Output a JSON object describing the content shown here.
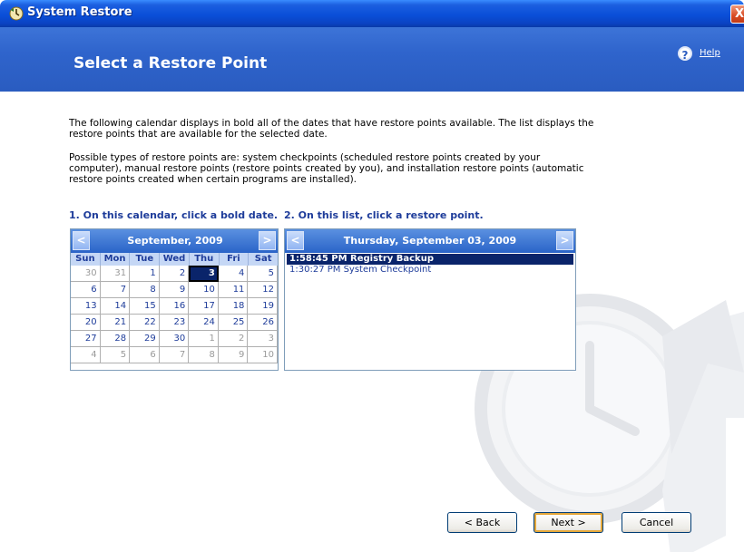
{
  "window": {
    "title": "System Restore",
    "close_glyph": "X"
  },
  "header": {
    "page_title": "Select a Restore Point",
    "help_label": "Help",
    "help_glyph": "?"
  },
  "intro": {
    "para1": "The following calendar displays in bold all of the dates that have restore points available. The list displays the restore points that are available for the selected date.",
    "para2": "Possible types of restore points are: system checkpoints (scheduled restore points created by your computer), manual restore points (restore points created by you), and installation restore points (automatic restore points created when certain programs are installed)."
  },
  "steps": {
    "step1": "1. On this calendar, click a bold date.",
    "step2": "2. On this list, click a restore point."
  },
  "calendar": {
    "prev_glyph": "<",
    "next_glyph": ">",
    "month": "September, 2009",
    "weekdays": [
      "Sun",
      "Mon",
      "Tue",
      "Wed",
      "Thu",
      "Fri",
      "Sat"
    ],
    "days": [
      {
        "label": "30",
        "state": "other"
      },
      {
        "label": "31",
        "state": "other"
      },
      {
        "label": "1",
        "state": "current"
      },
      {
        "label": "2",
        "state": "current"
      },
      {
        "label": "3",
        "state": "selected"
      },
      {
        "label": "4",
        "state": "current"
      },
      {
        "label": "5",
        "state": "current"
      },
      {
        "label": "6",
        "state": "current"
      },
      {
        "label": "7",
        "state": "current"
      },
      {
        "label": "8",
        "state": "current"
      },
      {
        "label": "9",
        "state": "current"
      },
      {
        "label": "10",
        "state": "current"
      },
      {
        "label": "11",
        "state": "current"
      },
      {
        "label": "12",
        "state": "current"
      },
      {
        "label": "13",
        "state": "current"
      },
      {
        "label": "14",
        "state": "current"
      },
      {
        "label": "15",
        "state": "current"
      },
      {
        "label": "16",
        "state": "current"
      },
      {
        "label": "17",
        "state": "current"
      },
      {
        "label": "18",
        "state": "current"
      },
      {
        "label": "19",
        "state": "current"
      },
      {
        "label": "20",
        "state": "current"
      },
      {
        "label": "21",
        "state": "current"
      },
      {
        "label": "22",
        "state": "current"
      },
      {
        "label": "23",
        "state": "current"
      },
      {
        "label": "24",
        "state": "current"
      },
      {
        "label": "25",
        "state": "current"
      },
      {
        "label": "26",
        "state": "current"
      },
      {
        "label": "27",
        "state": "current"
      },
      {
        "label": "28",
        "state": "current"
      },
      {
        "label": "29",
        "state": "current"
      },
      {
        "label": "30",
        "state": "current"
      },
      {
        "label": "1",
        "state": "other"
      },
      {
        "label": "2",
        "state": "other"
      },
      {
        "label": "3",
        "state": "other"
      },
      {
        "label": "4",
        "state": "other"
      },
      {
        "label": "5",
        "state": "other"
      },
      {
        "label": "6",
        "state": "other"
      },
      {
        "label": "7",
        "state": "other"
      },
      {
        "label": "8",
        "state": "other"
      },
      {
        "label": "9",
        "state": "other"
      },
      {
        "label": "10",
        "state": "other"
      }
    ]
  },
  "restore_list": {
    "prev_glyph": "<",
    "next_glyph": ">",
    "date": "Thursday, September 03, 2009",
    "items": [
      {
        "text": "1:58:45 PM  Registry Backup",
        "selected": true
      },
      {
        "text": "1:30:27 PM  System Checkpoint",
        "selected": false
      }
    ]
  },
  "buttons": {
    "back": "< Back",
    "next": "Next >",
    "cancel": "Cancel"
  },
  "colors": {
    "title_bar": "#0a4fd8",
    "header": "#2f64cc",
    "selection": "#0a246a",
    "link_text": "#1e3c9a"
  }
}
